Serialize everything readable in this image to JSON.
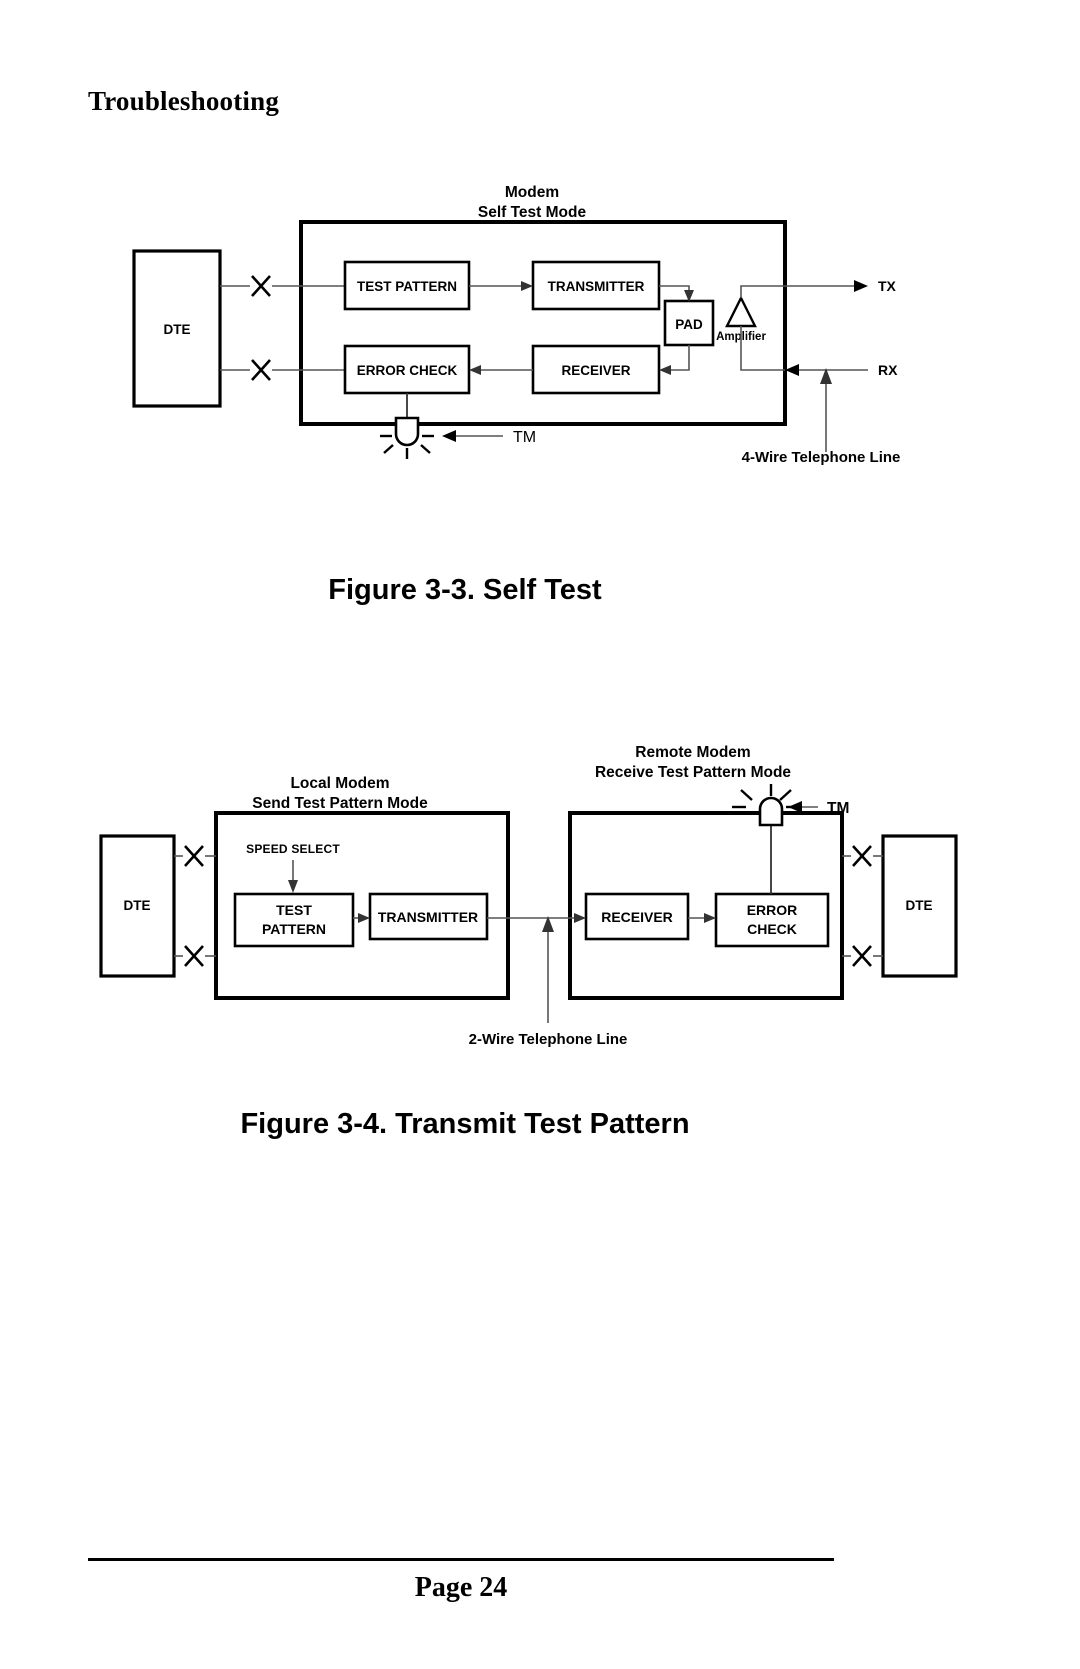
{
  "document": {
    "section_title": "Troubleshooting",
    "footer_page_label": "Page 24"
  },
  "figure_self_test": {
    "caption": "Figure 3-3. Self Test",
    "modem_title_line1": "Modem",
    "modem_title_line2": "Self Test Mode",
    "dte_label": "DTE",
    "block_test_pattern": "TEST PATTERN",
    "block_transmitter": "TRANSMITTER",
    "block_error_check": "ERROR CHECK",
    "block_receiver": "RECEIVER",
    "block_pad": "PAD",
    "label_amplifier": "Amplifier",
    "label_tx": "TX",
    "label_rx": "RX",
    "label_tm": "TM",
    "label_telephone_line": "4-Wire Telephone Line"
  },
  "figure_transmit_test_pattern": {
    "caption": "Figure 3-4. Transmit Test Pattern",
    "local_modem_line1": "Local Modem",
    "local_modem_line2": "Send Test Pattern Mode",
    "remote_modem_line1": "Remote Modem",
    "remote_modem_line2": "Receive Test Pattern Mode",
    "dte_left_label": "DTE",
    "dte_right_label": "DTE",
    "label_speed_select": "SPEED SELECT",
    "block_test_pattern_line1": "TEST",
    "block_test_pattern_line2": "PATTERN",
    "block_transmitter": "TRANSMITTER",
    "block_receiver": "RECEIVER",
    "block_error_check_line1": "ERROR",
    "block_error_check_line2": "CHECK",
    "label_tm": "TM",
    "label_telephone_line": "2-Wire Telephone Line"
  },
  "colors": {
    "ink": "#000000",
    "wire": "#555555",
    "paper": "#ffffff"
  }
}
